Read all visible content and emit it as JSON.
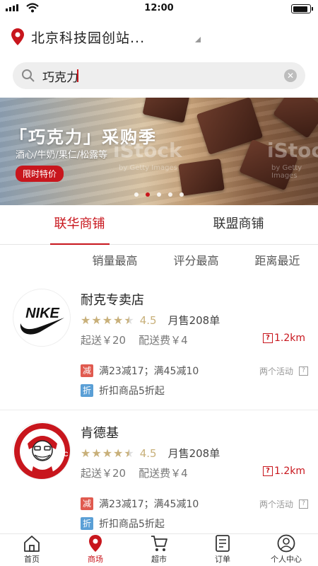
{
  "status_bar": {
    "time": "12:00"
  },
  "location": {
    "text": "北京科技园创站..."
  },
  "search": {
    "value": "巧克力"
  },
  "banner": {
    "title": "「巧克力」采购季",
    "subtitle": "酒心/牛奶/果仁/松露等",
    "badge": "限时特价",
    "watermark": "iStock",
    "watermark_sub": "by Getty Images",
    "dots": 5,
    "active_dot": 1
  },
  "tabs": [
    {
      "label": "联华商铺",
      "active": true
    },
    {
      "label": "联盟商铺",
      "active": false
    }
  ],
  "sort_options": [
    "销量最高",
    "评分最高",
    "距离最近"
  ],
  "stores": [
    {
      "name": "耐克专卖店",
      "logo": "nike-logo",
      "rating": 4.5,
      "score": "4.5",
      "sales": "月售208单",
      "min_order": "起送￥20",
      "delivery_fee": "配送费￥4",
      "distance": "1.2km",
      "promos": [
        {
          "tag": "减",
          "color": "red",
          "text": "满23减17；满45减10"
        },
        {
          "tag": "折",
          "color": "blue",
          "text": "折扣商品5折起"
        }
      ],
      "activities": "两个活动"
    },
    {
      "name": "肯德基",
      "logo": "kfc-logo",
      "rating": 4.5,
      "score": "4.5",
      "sales": "月售208单",
      "min_order": "起送￥20",
      "delivery_fee": "配送费￥4",
      "distance": "1.2km",
      "promos": [
        {
          "tag": "减",
          "color": "red",
          "text": "满23减17；满45减10"
        },
        {
          "tag": "折",
          "color": "blue",
          "text": "折扣商品5折起"
        }
      ],
      "activities": "两个活动"
    }
  ],
  "nav": [
    {
      "label": "首页",
      "icon": "home-icon",
      "active": false
    },
    {
      "label": "商场",
      "icon": "location-pin-icon",
      "active": true
    },
    {
      "label": "超市",
      "icon": "cart-icon",
      "active": false
    },
    {
      "label": "订单",
      "icon": "order-icon",
      "active": false
    },
    {
      "label": "个人中心",
      "icon": "user-icon",
      "active": false
    }
  ],
  "colors": {
    "accent": "#c8161d",
    "star": "#c8b07a"
  }
}
